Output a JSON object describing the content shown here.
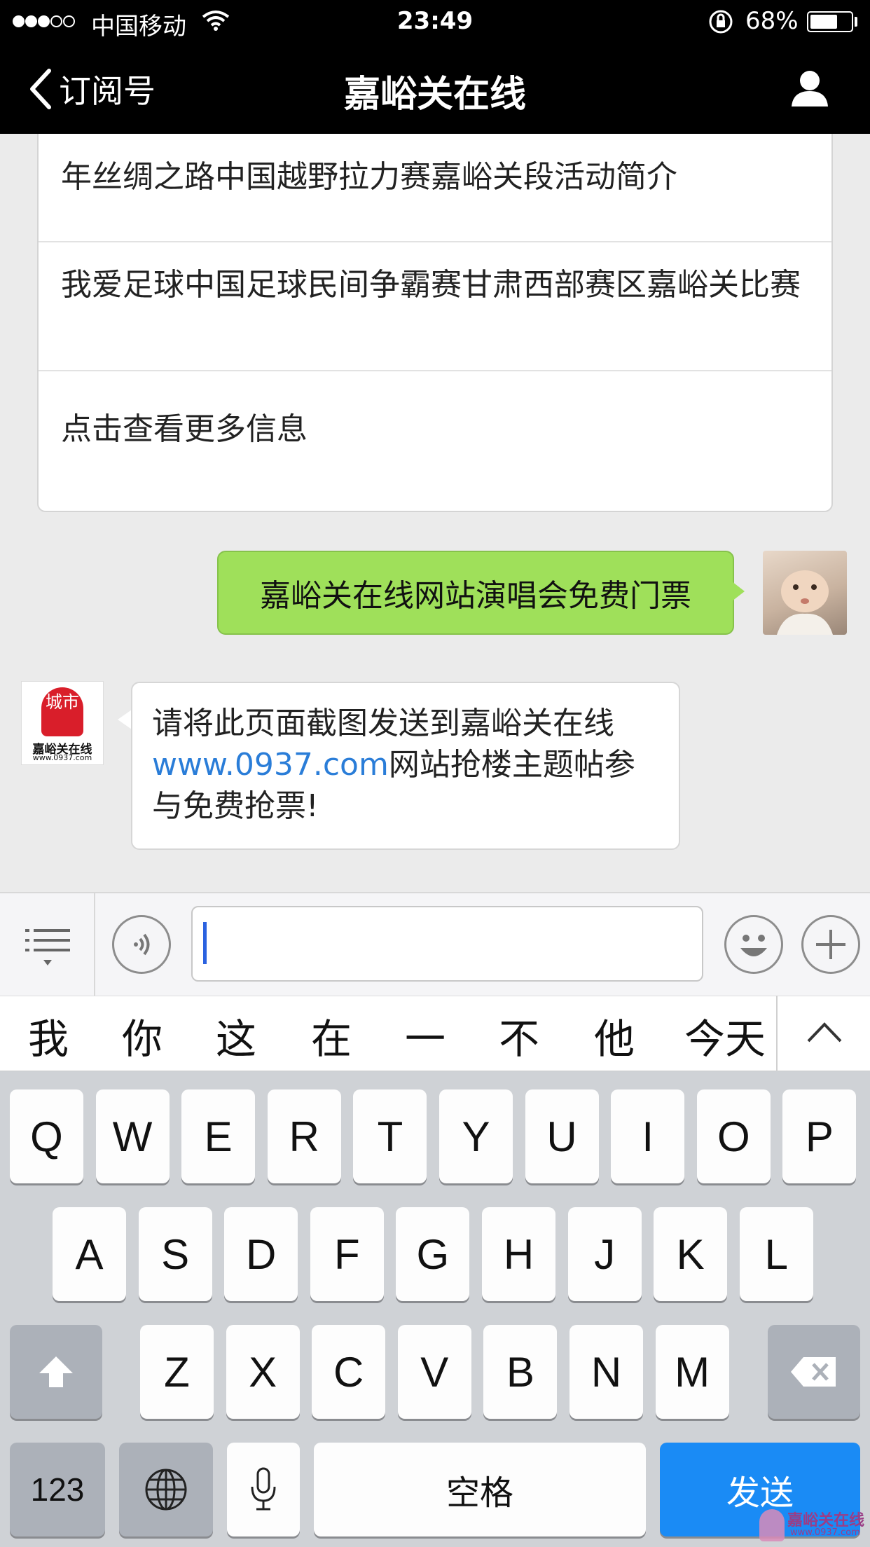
{
  "status_bar": {
    "signal_dots": [
      true,
      true,
      true,
      false,
      false
    ],
    "carrier": "中国移动",
    "time": "23:49",
    "battery_percent": "68%",
    "battery_level": 0.68
  },
  "nav": {
    "back_label": "订阅号",
    "title": "嘉峪关在线",
    "profile_icon": "person-icon"
  },
  "article_list": [
    "年丝绸之路中国越野拉力赛嘉峪关段活动简介",
    "我爱足球中国足球民间争霸赛甘肃西部赛区嘉峪关比赛",
    "点击查看更多信息"
  ],
  "messages": {
    "sent": {
      "text": "嘉峪关在线网站演唱会免费门票"
    },
    "received": {
      "line1": "请将此页面截图发送到嘉峪关在线",
      "link": "www.0937.com",
      "rest1": "网站抢楼主题帖参",
      "rest2": "与免费抢票!"
    },
    "sender_avatar_label": "城市",
    "sender_avatar_caption": "嘉峪关在线",
    "sender_avatar_url": "www.0937.com"
  },
  "input_bar": {
    "menu_icon": "list-menu-icon",
    "voice_icon": "voice-icon",
    "emoji_icon": "smiley-icon",
    "plus_icon": "plus-icon",
    "value": ""
  },
  "suggestions": [
    "我",
    "你",
    "这",
    "在",
    "一",
    "不",
    "他",
    "今天"
  ],
  "keyboard": {
    "row1": [
      "Q",
      "W",
      "E",
      "R",
      "T",
      "Y",
      "U",
      "I",
      "O",
      "P"
    ],
    "row2": [
      "A",
      "S",
      "D",
      "F",
      "G",
      "H",
      "J",
      "K",
      "L"
    ],
    "row3": [
      "Z",
      "X",
      "C",
      "V",
      "B",
      "N",
      "M"
    ],
    "num_label": "123",
    "space_label": "空格",
    "send_label": "发送"
  },
  "watermark": {
    "brand": "嘉峪关在线",
    "url": "www.0937.com"
  }
}
